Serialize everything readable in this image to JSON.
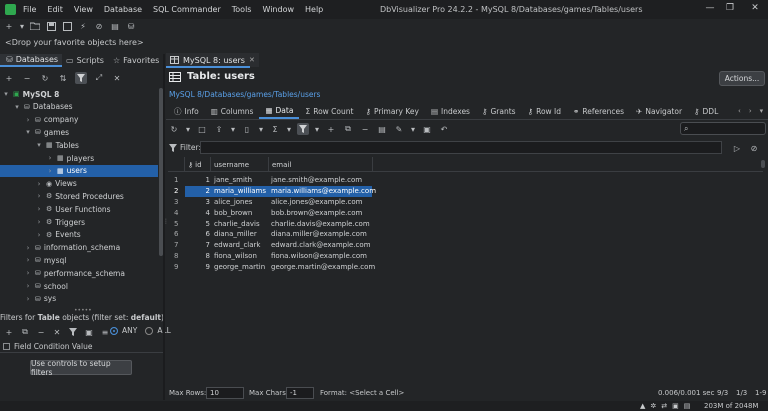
{
  "window": {
    "title": "DbVisualizer Pro 24.2.2 - MySQL 8/Databases/games/Tables/users",
    "controls": [
      "—",
      "❐",
      "✕"
    ]
  },
  "menu": [
    "File",
    "Edit",
    "View",
    "Database",
    "SQL Commander",
    "Tools",
    "Window",
    "Help"
  ],
  "drop_hint": "<Drop your favorite objects here>",
  "left_tabs": {
    "databases": "Databases",
    "scripts": "Scripts",
    "favorites": "Favorites"
  },
  "tree": [
    {
      "label": "MySQL 8",
      "level": 0,
      "arrow": "▾",
      "icon": "server-icon",
      "bold": true
    },
    {
      "label": "Databases",
      "level": 1,
      "arrow": "▾",
      "icon": "databases-icon"
    },
    {
      "label": "company",
      "level": 2,
      "arrow": "›",
      "icon": "database-icon"
    },
    {
      "label": "games",
      "level": 2,
      "arrow": "▾",
      "icon": "database-icon"
    },
    {
      "label": "Tables",
      "level": 3,
      "arrow": "▾",
      "icon": "tables-icon"
    },
    {
      "label": "players",
      "level": 4,
      "arrow": "›",
      "icon": "table-icon"
    },
    {
      "label": "users",
      "level": 4,
      "arrow": "›",
      "icon": "table-icon",
      "selected": true
    },
    {
      "label": "Views",
      "level": 3,
      "arrow": "›",
      "icon": "views-icon"
    },
    {
      "label": "Stored Procedures",
      "level": 3,
      "arrow": "›",
      "icon": "procedure-icon"
    },
    {
      "label": "User Functions",
      "level": 3,
      "arrow": "›",
      "icon": "function-icon"
    },
    {
      "label": "Triggers",
      "level": 3,
      "arrow": "›",
      "icon": "trigger-icon"
    },
    {
      "label": "Events",
      "level": 3,
      "arrow": "›",
      "icon": "event-icon"
    },
    {
      "label": "information_schema",
      "level": 2,
      "arrow": "›",
      "icon": "database-icon"
    },
    {
      "label": "mysql",
      "level": 2,
      "arrow": "›",
      "icon": "database-icon"
    },
    {
      "label": "performance_schema",
      "level": 2,
      "arrow": "›",
      "icon": "database-icon"
    },
    {
      "label": "school",
      "level": 2,
      "arrow": "›",
      "icon": "database-icon"
    },
    {
      "label": "sys",
      "level": 2,
      "arrow": "›",
      "icon": "database-icon"
    }
  ],
  "filters": {
    "prefix": "Filters for ",
    "object": "Table",
    "mid": " objects (filter set: ",
    "set": "default",
    "suffix": ")",
    "any": "ANY",
    "all": "ALL",
    "condition_label": "Field Condition Value",
    "setup_button": "Use controls to setup filters"
  },
  "editor_tab": {
    "label": "MySQL 8: users",
    "close": "✕"
  },
  "table_header": {
    "title": "Table: users",
    "actions": "Actions..."
  },
  "breadcrumb": "MySQL 8/Databases/games/Tables/users",
  "subtabs": [
    {
      "label": "Info",
      "icon": "info-icon"
    },
    {
      "label": "Columns",
      "icon": "columns-icon"
    },
    {
      "label": "Data",
      "icon": "data-icon",
      "active": true
    },
    {
      "label": "Row Count",
      "icon": "sigma-icon"
    },
    {
      "label": "Primary Key",
      "icon": "key-icon"
    },
    {
      "label": "Indexes",
      "icon": "index-icon"
    },
    {
      "label": "Grants",
      "icon": "grants-icon"
    },
    {
      "label": "Row Id",
      "icon": "key-icon"
    },
    {
      "label": "References",
      "icon": "references-icon"
    },
    {
      "label": "Navigator",
      "icon": "navigator-icon"
    },
    {
      "label": "DDL",
      "icon": "ddl-icon"
    }
  ],
  "filter_label": "Filter:",
  "grid": {
    "columns": [
      "id",
      "username",
      "email"
    ],
    "rows": [
      {
        "num": "1",
        "id": "1",
        "username": "jane_smith",
        "email": "jane.smith@example.com"
      },
      {
        "num": "2",
        "id": "2",
        "username": "maria_williams",
        "email": "maria.williams@example.com",
        "selected": true
      },
      {
        "num": "3",
        "id": "3",
        "username": "alice_jones",
        "email": "alice.jones@example.com"
      },
      {
        "num": "4",
        "id": "4",
        "username": "bob_brown",
        "email": "bob.brown@example.com"
      },
      {
        "num": "5",
        "id": "5",
        "username": "charlie_davis",
        "email": "charlie.davis@example.com"
      },
      {
        "num": "6",
        "id": "6",
        "username": "diana_miller",
        "email": "diana.miller@example.com"
      },
      {
        "num": "7",
        "id": "7",
        "username": "edward_clark",
        "email": "edward.clark@example.com"
      },
      {
        "num": "8",
        "id": "8",
        "username": "fiona_wilson",
        "email": "fiona.wilson@example.com"
      },
      {
        "num": "9",
        "id": "9",
        "username": "george_martin",
        "email": "george.martin@example.com"
      }
    ]
  },
  "status": {
    "max_rows_label": "Max Rows:",
    "max_rows_value": "10",
    "max_chars_label": "Max Chars:",
    "max_chars_value": "-1",
    "format": "Format: <Select a Cell>",
    "timing": "0.006/0.001 sec",
    "rows": "9/3",
    "page": "1/3",
    "range": "1-9",
    "memory": "203M of 2048M"
  }
}
